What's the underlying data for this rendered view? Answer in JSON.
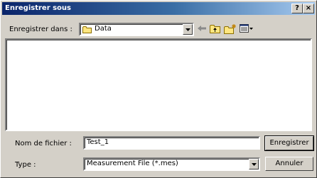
{
  "window": {
    "title": "Enregistrer sous"
  },
  "titlebar_buttons": {
    "help": "?",
    "close": "×"
  },
  "location": {
    "label": "Enregistrer dans :",
    "value": "Data"
  },
  "toolbar_icons": [
    "back-arrow-icon",
    "up-folder-icon",
    "new-folder-icon",
    "view-menu-icon"
  ],
  "file_list": {
    "items": []
  },
  "filename": {
    "label": "Nom de fichier :",
    "value": "Test_1"
  },
  "filetype": {
    "label": "Type :",
    "value": "Measurement File (*.mes)"
  },
  "buttons": {
    "save": "Enregistrer",
    "cancel": "Annuler"
  },
  "colors": {
    "dialog_bg": "#d4d0c8",
    "title_start": "#0a246a",
    "title_end": "#a6caf0"
  }
}
